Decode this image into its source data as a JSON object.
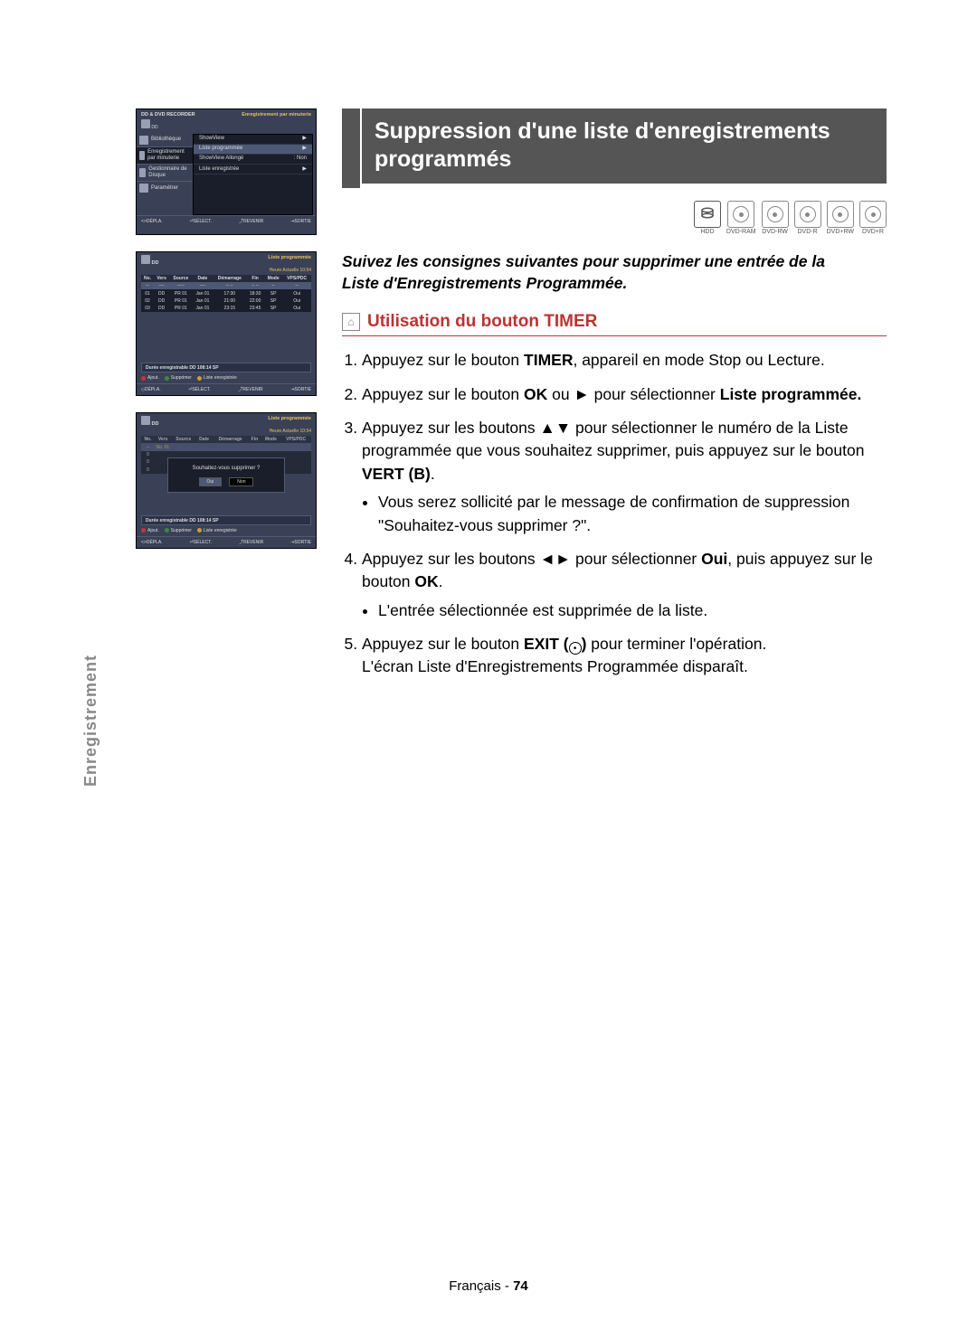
{
  "sidebar_label": "Enregistrement",
  "osd1": {
    "title_left": "DD & DVD RECORDER",
    "title_right": "Enregistrement par minuterie",
    "dd": "DD",
    "left_menu": [
      "Bibliothèque",
      "Enregistrement par minuterie",
      "Gestionnaire de Disque",
      "Paramétrer"
    ],
    "right_menu": [
      {
        "l": "ShowView",
        "r": "▶"
      },
      {
        "l": "Liste programmée",
        "r": "▶"
      },
      {
        "l": "ShowView Allongé",
        "r": ": Non"
      },
      {
        "l": "Liste enregistrée",
        "r": "▶"
      }
    ],
    "footer": [
      "<>DÉPLA.",
      "⏎SÉLECT.",
      "⤴REVENIR",
      "⇥SORTIE"
    ]
  },
  "osd2": {
    "dd": "DD",
    "title": "Liste programmée",
    "time": "Heure Actuelle 10:54",
    "cols": [
      "No.",
      "Vers",
      "Source",
      "Date",
      "Démarrage",
      "Fin",
      "Mode",
      "VPS/PDC"
    ],
    "row_hdr": [
      "--",
      "----",
      "-----",
      "----",
      "-- --",
      "-- --",
      "--",
      "--"
    ],
    "rows": [
      [
        "01",
        "DD",
        "PR 01",
        "Jan 01",
        "17:30",
        "18:30",
        "SP",
        "Oui"
      ],
      [
        "02",
        "DD",
        "PR 01",
        "Jan 01",
        "21:00",
        "22:00",
        "SP",
        "Oui"
      ],
      [
        "03",
        "DD",
        "PR 01",
        "Jan 01",
        "23:15",
        "23:45",
        "SP",
        "Oui"
      ]
    ],
    "duration": "Durée enregistrable  DD 108:14 SP",
    "actions": [
      "Ajout.",
      "Supprimer",
      "Liste enregistrée"
    ],
    "footer": [
      "◇DÉPLA.",
      "⏎SÉLECT.",
      "⤴REVENIR",
      "⇥SORTIE"
    ]
  },
  "osd3": {
    "dd": "DD",
    "title": "Liste programmée",
    "time": "Heure Actuelle 10:54",
    "cols": [
      "No.",
      "Vers",
      "Source",
      "Date",
      "Démarrage",
      "Fin",
      "Mode",
      "VPS/PDC"
    ],
    "rows_ghost": [
      [
        "0"
      ],
      [
        "0"
      ],
      [
        "0"
      ]
    ],
    "highlighted_id": "No. 01",
    "confirm_q": "Souhaitez-vous supprimer ?",
    "btn_yes": "Oui",
    "btn_no": "Non",
    "duration": "Durée enregistrable  DD 108:14 SP",
    "actions": [
      "Ajout.",
      "Supprimer",
      "Liste enregistrée"
    ],
    "footer": [
      "<>DÉPLA.",
      "⏎SÉLECT.",
      "⤴REVENIR",
      "⇥SORTIE"
    ]
  },
  "title": "Suppression d'une liste d'enregistrements programmés",
  "discs": [
    "HDD",
    "DVD-RAM",
    "DVD-RW",
    "DVD-R",
    "DVD+RW",
    "DVD+R"
  ],
  "intro_line1": "Suivez les consignes suivantes pour supprimer une entrée de la",
  "intro_line2": "Liste d'Enregistrements Programmée.",
  "section_heading": "Utilisation du bouton TIMER",
  "steps": {
    "s1a": "Appuyez sur le bouton ",
    "s1b": "TIMER",
    "s1c": ", appareil en mode Stop ou Lecture.",
    "s2a": "Appuyez sur le bouton ",
    "s2b": "OK",
    "s2c": " ou ► pour sélectionner ",
    "s2d": "Liste programmée.",
    "s3a": "Appuyez sur les boutons ▲▼ pour sélectionner le numéro de la Liste programmée que vous souhaitez supprimer, puis appuyez sur le bouton ",
    "s3b": "VERT (B)",
    "s3c": ".",
    "s3_bullet": "Vous serez sollicité par le message de confirmation de suppression \"Souhaitez-vous supprimer ?\".",
    "s4a": "Appuyez sur les boutons ◄► pour sélectionner ",
    "s4b": "Oui",
    "s4c": ", puis appuyez sur le bouton ",
    "s4d": "OK",
    "s4e": ".",
    "s4_bullet": "L'entrée sélectionnée est supprimée de la liste.",
    "s5a": "Appuyez sur le bouton ",
    "s5b": "EXIT (",
    "s5c": ")",
    "s5d": " pour terminer l'opération.",
    "s5_line2": "L'écran Liste d'Enregistrements Programmée disparaît."
  },
  "footer_lang": "Français - ",
  "footer_page": "74"
}
